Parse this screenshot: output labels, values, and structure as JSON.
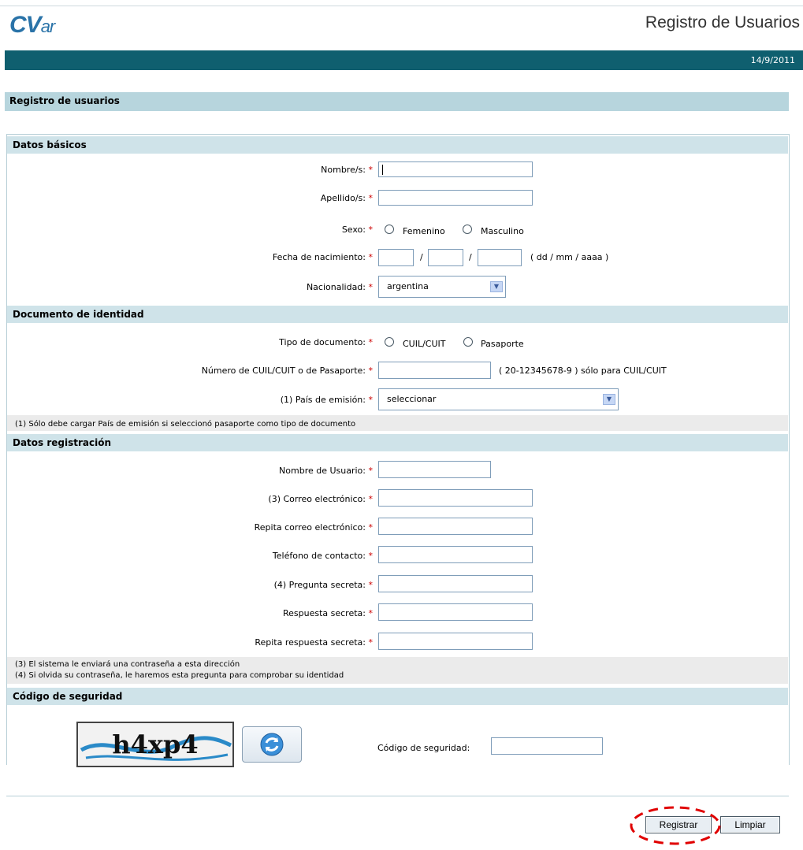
{
  "header": {
    "logo": "CV",
    "logo_sub": "ar",
    "title": "Registro de Usuarios",
    "date": "14/9/2011"
  },
  "page": {
    "section_title": "Registro de usuarios"
  },
  "datos_basicos": {
    "title": "Datos básicos",
    "nombre_label": "Nombre/s:",
    "apellido_label": "Apellido/s:",
    "sexo_label": "Sexo:",
    "sexo_femenino": "Femenino",
    "sexo_masculino": "Masculino",
    "fecha_label": "Fecha de nacimiento:",
    "fecha_sep": "/",
    "fecha_hint": "( dd / mm / aaaa )",
    "nacionalidad_label": "Nacionalidad:",
    "nacionalidad_value": "argentina"
  },
  "documento": {
    "title": "Documento de identidad",
    "tipo_label": "Tipo de documento:",
    "tipo_cuil": "CUIL/CUIT",
    "tipo_pasaporte": "Pasaporte",
    "numero_label": "Número de CUIL/CUIT o de Pasaporte:",
    "numero_hint": "( 20-12345678-9 ) sólo para CUIL/CUIT",
    "pais_label": "(1) País de emisión:",
    "pais_value": "seleccionar",
    "note": "(1) Sólo debe cargar País de emisión si seleccionó pasaporte como tipo de documento"
  },
  "registracion": {
    "title": "Datos registración",
    "usuario_label": "Nombre de Usuario:",
    "correo_label": "(3) Correo electrónico:",
    "repita_correo_label": "Repita correo electrónico:",
    "telefono_label": "Teléfono de contacto:",
    "pregunta_label": "(4) Pregunta secreta:",
    "respuesta_label": "Respuesta secreta:",
    "repita_respuesta_label": "Repita respuesta secreta:",
    "note3": "(3) El sistema le enviará una contraseña a esta dirección",
    "note4": "(4) Si olvida su contraseña, le haremos esta pregunta para comprobar su identidad"
  },
  "seguridad": {
    "title": "Código de seguridad",
    "captcha_text": "h4xp4",
    "codigo_label": "Código de seguridad:"
  },
  "buttons": {
    "registrar": "Registrar",
    "limpiar": "Limpiar"
  },
  "required_mark": "*",
  "colors": {
    "header_bar": "#0f5f6f",
    "section_bar": "#b7d5dd",
    "group_header": "#cfe3e9",
    "required": "#cc0000",
    "annotation": "#e00000"
  },
  "icons": [
    "refresh-icon",
    "chevron-down-icon",
    "radio-icon"
  ]
}
